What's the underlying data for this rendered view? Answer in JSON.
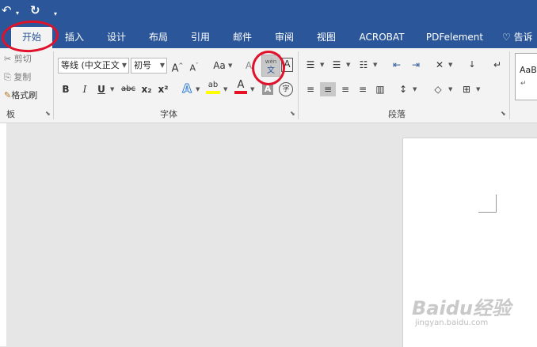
{
  "quick_access": {
    "undo_icon": "↶",
    "redo_icon": "↻",
    "more_icon": "▾"
  },
  "tabs": [
    "开始",
    "插入",
    "设计",
    "布局",
    "引用",
    "邮件",
    "审阅",
    "视图",
    "ACROBAT",
    "PDFelement"
  ],
  "tell_me": "告诉",
  "clipboard": {
    "cut": "剪切",
    "copy": "复制",
    "format_painter": "格式刷",
    "group_label": "板"
  },
  "font": {
    "font_name": "等线 (中文正文",
    "font_size": "初号",
    "group_label": "字体",
    "grow_label": "A",
    "shrink_label": "A",
    "change_case": "Aa",
    "clear_format": "A",
    "phonetic_top": "wén",
    "phonetic_bottom": "文",
    "char_border": "A",
    "bold": "B",
    "italic": "I",
    "underline": "U",
    "strike": "abc",
    "subscript": "x₂",
    "superscript": "x²",
    "text_effect": "A",
    "highlight": "ab",
    "font_color": "A",
    "char_shading": "A",
    "enclose": "字"
  },
  "paragraph": {
    "group_label": "段落"
  },
  "styles": {
    "sample": "AaBb"
  },
  "colors": {
    "accent": "#2b579a",
    "annotation": "#e0112b",
    "highlight": "#ffff00",
    "font_color": "#e81123"
  },
  "watermark": {
    "brand": "Baidu经验",
    "url": "jingyan.baidu.com"
  }
}
